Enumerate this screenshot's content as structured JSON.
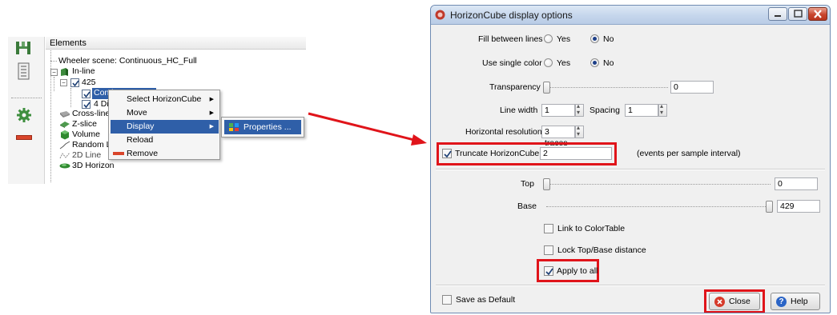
{
  "tree": {
    "header": "Elements",
    "scene": "Wheeler scene: Continuous_HC_Full",
    "inline": "In-line",
    "line425": "425",
    "cont_item": "Continuous_HC_Full",
    "fourdi_item": "4 Di",
    "crossline": "Cross-line",
    "zslice": "Z-slice",
    "volume": "Volume",
    "random": "Random L",
    "line2d": "2D Line",
    "horizon3d": "3D Horizon"
  },
  "context_menu": {
    "items": [
      "Select HorizonCube",
      "Move",
      "Display",
      "Reload",
      "Remove"
    ],
    "submenu": "Properties ..."
  },
  "dialog": {
    "title": "HorizonCube display options",
    "fill_label": "Fill between lines",
    "fill_value": "No",
    "single_color_label": "Use single color",
    "single_color_value": "No",
    "yes": "Yes",
    "no": "No",
    "transparency_label": "Transparency",
    "transparency_value": "0",
    "line_width_label": "Line width",
    "line_width_value": "1",
    "spacing_label": "Spacing",
    "spacing_value": "1",
    "hres_label": "Horizontal resolution",
    "hres_value": "3 traces",
    "truncate_label": "Truncate HorizonCube",
    "truncate_checked": true,
    "truncate_value": "2",
    "truncate_unit": "(events per sample interval)",
    "top_label": "Top",
    "top_value": "0",
    "base_label": "Base",
    "base_value": "429",
    "link_color_label": "Link to ColorTable",
    "link_color_checked": false,
    "lock_label": "Lock Top/Base distance",
    "lock_checked": false,
    "apply_all_label": "Apply to all",
    "apply_all_checked": true,
    "save_default_label": "Save as Default",
    "save_default_checked": false,
    "close_label": "Close",
    "help_label": "Help"
  },
  "colors": {
    "highlight_red": "#e0141a",
    "menu_highlight": "#2f5fa8",
    "title_bar": "#c5d6ec",
    "dialog_bg": "#f0f0f0"
  }
}
